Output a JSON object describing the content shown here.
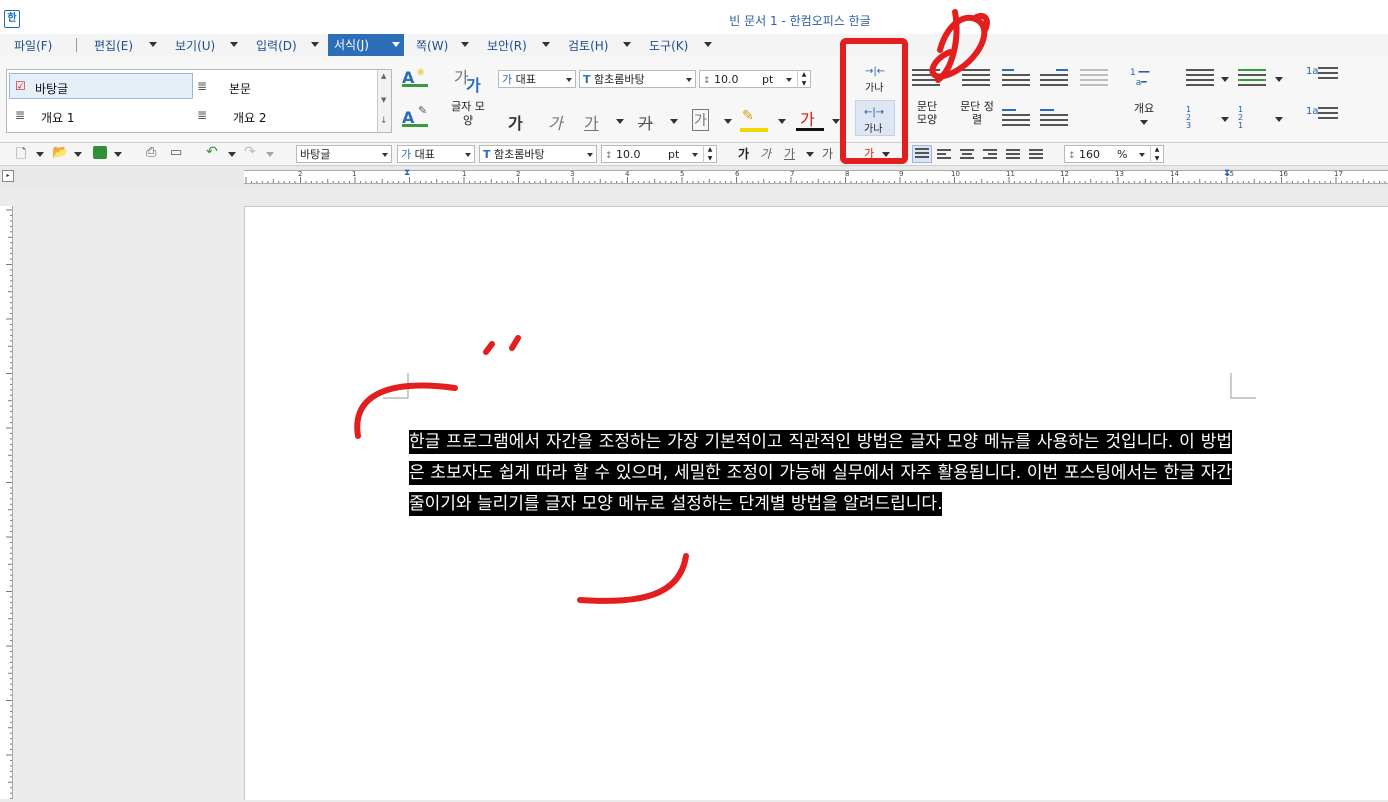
{
  "window": {
    "title": "빈 문서 1 - 한컴오피스 한글",
    "app_icon_glyph": "한"
  },
  "menu": [
    {
      "label": "파일(F)"
    },
    {
      "label": "편집(E)"
    },
    {
      "label": "보기(U)"
    },
    {
      "label": "입력(D)"
    },
    {
      "label": "서식(J)",
      "active": true
    },
    {
      "label": "쪽(W)"
    },
    {
      "label": "보안(R)"
    },
    {
      "label": "검토(H)"
    },
    {
      "label": "도구(K)"
    }
  ],
  "styles_panel": {
    "items": [
      {
        "label": "바탕글",
        "selected": true
      },
      {
        "label": "본문"
      },
      {
        "label": "개요 1"
      },
      {
        "label": "개요 2"
      }
    ]
  },
  "ribbon": {
    "char_shape_label": "글자 모양",
    "font_lang": "대표",
    "font_name": "함초롬바탕",
    "font_size": "10.0",
    "font_unit": "pt",
    "bold_glyph": "가",
    "italic_glyph": "가",
    "underline_glyph": "가",
    "strike_glyph": "가",
    "outline_glyph": "가",
    "highlight_glyph": "가",
    "fontcolor_glyph": "가",
    "spacing_narrow_label": "가나",
    "spacing_wide_label": "가나",
    "para_shape_label": "문단 모양",
    "para_align_label": "문단 정렬",
    "outline_label": "개요",
    "list_numbers_a": "1 2 3",
    "list_numbers_b": "1 2 1",
    "line_up_label": "1a",
    "line_down_label": "1a",
    "spacing_top_label": "가",
    "spacing_top_label2": "가"
  },
  "toolbar": {
    "style_value": "바탕글",
    "font_lang": "대표",
    "font_name": "함초롬바탕",
    "font_size": "10.0",
    "font_unit": "pt",
    "bold_glyph": "가",
    "italic_glyph": "가",
    "underline_glyph": "가",
    "spacing_glyph": "가",
    "color_glyph": "가",
    "line_spacing": "160",
    "line_spacing_unit": "%"
  },
  "ruler": {
    "numbers": [
      "2",
      "1",
      "1",
      "1",
      "2",
      "3",
      "4",
      "5",
      "6",
      "7",
      "8",
      "9",
      "10",
      "11",
      "12",
      "13",
      "14",
      "15",
      "16",
      "17"
    ]
  },
  "document": {
    "body": "한글 프로그램에서 자간을 조정하는 가장 기본적이고 직관적인 방법은 글자 모양 메뉴를 사용하는 것입니다. 이 방법은 초보자도 쉽게 따라 할 수 있으며, 세밀한 조정이 가능해 실무에서 자주 활용됩니다. 이번 포스팅에서는 한글 자간 줄이기와 늘리기를 글자 모양 메뉴로 설정하는 단계별 방법을 알려드립니다."
  },
  "colors": {
    "accent": "#2c6eb8",
    "annotation_red": "#e31e1e",
    "selection_bg": "#000000",
    "selection_fg": "#ffffff"
  }
}
